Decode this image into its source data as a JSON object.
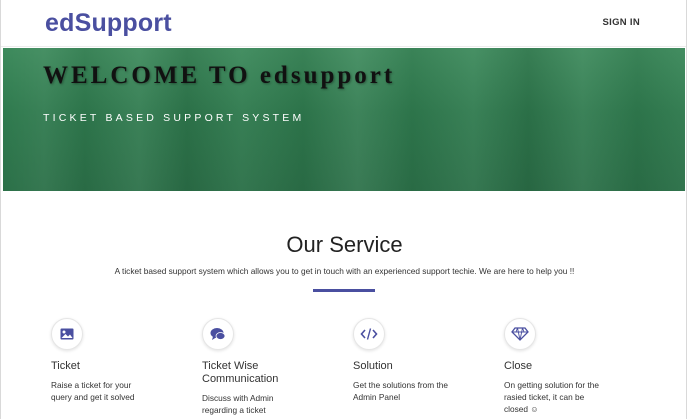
{
  "navbar": {
    "brand": "edSupport",
    "signin_label": "SIGN IN"
  },
  "hero": {
    "title": "WELCOME TO edsupport",
    "subtitle": "TICKET BASED SUPPORT SYSTEM"
  },
  "service": {
    "title": "Our Service",
    "description": "A ticket based support system which allows you to get in touch with an experienced support techie. We are here to help you !!",
    "features": [
      {
        "icon": "image-icon",
        "name": "Ticket",
        "description": "Raise a ticket for your query and get it solved"
      },
      {
        "icon": "chat-bubbles-icon",
        "name": "Ticket Wise Communication",
        "description": "Discuss with Admin regarding a ticket"
      },
      {
        "icon": "code-icon",
        "name": "Solution",
        "description": "Get the solutions from the Admin Panel"
      },
      {
        "icon": "diamond-icon",
        "name": "Close",
        "description": "On getting solution for the rasied ticket, it can be closed ☺"
      }
    ]
  },
  "colors": {
    "brand": "#4a4fa0",
    "hero_green": "#2f7a4e"
  }
}
